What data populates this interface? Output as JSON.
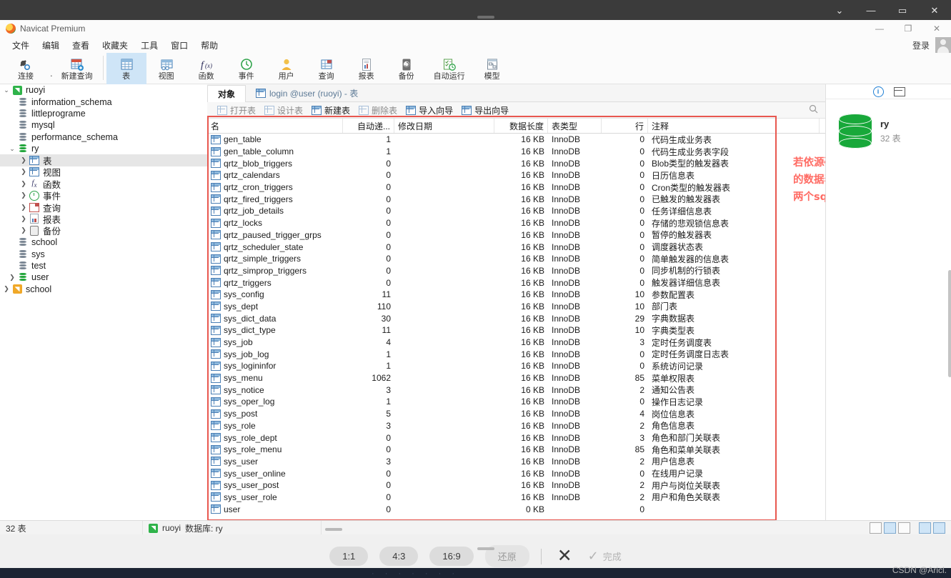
{
  "outer_window": {
    "buttons": [
      {
        "name": "chevron-down-icon",
        "glyph": "⌄"
      },
      {
        "name": "minimize-icon",
        "glyph": "—"
      },
      {
        "name": "maximize-icon",
        "glyph": "▭"
      },
      {
        "name": "close-icon",
        "glyph": "✕"
      }
    ]
  },
  "app": {
    "title": "Navicat Premium",
    "window_buttons": [
      {
        "name": "minimize-icon",
        "glyph": "—"
      },
      {
        "name": "restore-icon",
        "glyph": "❐"
      },
      {
        "name": "close-icon",
        "glyph": "✕"
      }
    ],
    "login_label": "登录"
  },
  "menu": {
    "items": [
      {
        "label": "文件"
      },
      {
        "label": "编辑"
      },
      {
        "label": "查看"
      },
      {
        "label": "收藏夹"
      },
      {
        "label": "工具"
      },
      {
        "label": "窗口"
      },
      {
        "label": "帮助"
      }
    ]
  },
  "ribbon": {
    "items": [
      {
        "label": "连接",
        "icon": "connection-icon",
        "active": false
      },
      {
        "label": "新建查询",
        "icon": "new-query-icon",
        "active": false
      },
      {
        "label": "表",
        "icon": "table-icon",
        "active": true
      },
      {
        "label": "视图",
        "icon": "view-icon",
        "active": false
      },
      {
        "label": "函数",
        "icon": "function-icon",
        "active": false
      },
      {
        "label": "事件",
        "icon": "event-icon",
        "active": false
      },
      {
        "label": "用户",
        "icon": "user-icon",
        "active": false
      },
      {
        "label": "查询",
        "icon": "query-icon",
        "active": false
      },
      {
        "label": "报表",
        "icon": "report-icon",
        "active": false
      },
      {
        "label": "备份",
        "icon": "backup-icon",
        "active": false
      },
      {
        "label": "自动运行",
        "icon": "automation-icon",
        "active": false
      },
      {
        "label": "模型",
        "icon": "model-icon",
        "active": false
      }
    ]
  },
  "sidebar": {
    "items": [
      {
        "label": "ruoyi",
        "icon": "connection-icon",
        "indent": 0,
        "twisty": "v",
        "selected": false
      },
      {
        "label": "information_schema",
        "icon": "database-icon",
        "indent": 1,
        "twisty": "",
        "selected": false
      },
      {
        "label": "littleprograme",
        "icon": "database-icon",
        "indent": 1,
        "twisty": "",
        "selected": false
      },
      {
        "label": "mysql",
        "icon": "database-icon",
        "indent": 1,
        "twisty": "",
        "selected": false
      },
      {
        "label": "performance_schema",
        "icon": "database-icon",
        "indent": 1,
        "twisty": "",
        "selected": false
      },
      {
        "label": "ry",
        "icon": "database-open-icon",
        "indent": 1,
        "twisty": "v",
        "selected": false
      },
      {
        "label": "表",
        "icon": "table-icon",
        "indent": 2,
        "twisty": ">",
        "selected": true
      },
      {
        "label": "视图",
        "icon": "view-icon",
        "indent": 2,
        "twisty": ">",
        "selected": false
      },
      {
        "label": "函数",
        "icon": "function-icon",
        "indent": 2,
        "twisty": ">",
        "selected": false
      },
      {
        "label": "事件",
        "icon": "event-icon",
        "indent": 2,
        "twisty": ">",
        "selected": false
      },
      {
        "label": "查询",
        "icon": "query-icon",
        "indent": 2,
        "twisty": ">",
        "selected": false
      },
      {
        "label": "报表",
        "icon": "report-icon",
        "indent": 2,
        "twisty": ">",
        "selected": false
      },
      {
        "label": "备份",
        "icon": "backup-icon",
        "indent": 2,
        "twisty": ">",
        "selected": false
      },
      {
        "label": "school",
        "icon": "database-icon",
        "indent": 1,
        "twisty": "",
        "selected": false
      },
      {
        "label": "sys",
        "icon": "database-icon",
        "indent": 1,
        "twisty": "",
        "selected": false
      },
      {
        "label": "test",
        "icon": "database-icon",
        "indent": 1,
        "twisty": "",
        "selected": false
      },
      {
        "label": "user",
        "icon": "database-open-icon",
        "indent": 1,
        "twisty": ">",
        "selected": false
      },
      {
        "label": "school",
        "icon": "connection-orange-icon",
        "indent": 0,
        "twisty": ">",
        "selected": false
      }
    ]
  },
  "tabs": [
    {
      "label": "对象",
      "active": true,
      "icon": ""
    },
    {
      "label": "login @user (ruoyi) - 表",
      "active": false,
      "icon": "table-icon"
    }
  ],
  "object_toolbar": [
    {
      "label": "打开表",
      "icon": "open-table-icon",
      "enabled": false
    },
    {
      "label": "设计表",
      "icon": "design-table-icon",
      "enabled": false
    },
    {
      "label": "新建表",
      "icon": "new-table-icon",
      "enabled": true
    },
    {
      "label": "删除表",
      "icon": "delete-table-icon",
      "enabled": false
    },
    {
      "label": "导入向导",
      "icon": "import-wizard-icon",
      "enabled": true
    },
    {
      "label": "导出向导",
      "icon": "export-wizard-icon",
      "enabled": true
    }
  ],
  "table_list": {
    "columns": [
      "名",
      "自动递...",
      "修改日期",
      "数据长度",
      "表类型",
      "行",
      "注释"
    ],
    "rows": [
      {
        "name": "gen_table",
        "auto": "1",
        "modified": "",
        "length": "16 KB",
        "type": "InnoDB",
        "rows": "0",
        "comment": "代码生成业务表"
      },
      {
        "name": "gen_table_column",
        "auto": "1",
        "modified": "",
        "length": "16 KB",
        "type": "InnoDB",
        "rows": "0",
        "comment": "代码生成业务表字段"
      },
      {
        "name": "qrtz_blob_triggers",
        "auto": "0",
        "modified": "",
        "length": "16 KB",
        "type": "InnoDB",
        "rows": "0",
        "comment": "Blob类型的触发器表"
      },
      {
        "name": "qrtz_calendars",
        "auto": "0",
        "modified": "",
        "length": "16 KB",
        "type": "InnoDB",
        "rows": "0",
        "comment": "日历信息表"
      },
      {
        "name": "qrtz_cron_triggers",
        "auto": "0",
        "modified": "",
        "length": "16 KB",
        "type": "InnoDB",
        "rows": "0",
        "comment": "Cron类型的触发器表"
      },
      {
        "name": "qrtz_fired_triggers",
        "auto": "0",
        "modified": "",
        "length": "16 KB",
        "type": "InnoDB",
        "rows": "0",
        "comment": "已触发的触发器表"
      },
      {
        "name": "qrtz_job_details",
        "auto": "0",
        "modified": "",
        "length": "16 KB",
        "type": "InnoDB",
        "rows": "0",
        "comment": "任务详细信息表"
      },
      {
        "name": "qrtz_locks",
        "auto": "0",
        "modified": "",
        "length": "16 KB",
        "type": "InnoDB",
        "rows": "0",
        "comment": "存储的悲观锁信息表"
      },
      {
        "name": "qrtz_paused_trigger_grps",
        "auto": "0",
        "modified": "",
        "length": "16 KB",
        "type": "InnoDB",
        "rows": "0",
        "comment": "暂停的触发器表"
      },
      {
        "name": "qrtz_scheduler_state",
        "auto": "0",
        "modified": "",
        "length": "16 KB",
        "type": "InnoDB",
        "rows": "0",
        "comment": "调度器状态表"
      },
      {
        "name": "qrtz_simple_triggers",
        "auto": "0",
        "modified": "",
        "length": "16 KB",
        "type": "InnoDB",
        "rows": "0",
        "comment": "简单触发器的信息表"
      },
      {
        "name": "qrtz_simprop_triggers",
        "auto": "0",
        "modified": "",
        "length": "16 KB",
        "type": "InnoDB",
        "rows": "0",
        "comment": "同步机制的行锁表"
      },
      {
        "name": "qrtz_triggers",
        "auto": "0",
        "modified": "",
        "length": "16 KB",
        "type": "InnoDB",
        "rows": "0",
        "comment": "触发器详细信息表"
      },
      {
        "name": "sys_config",
        "auto": "11",
        "modified": "",
        "length": "16 KB",
        "type": "InnoDB",
        "rows": "10",
        "comment": "参数配置表"
      },
      {
        "name": "sys_dept",
        "auto": "110",
        "modified": "",
        "length": "16 KB",
        "type": "InnoDB",
        "rows": "10",
        "comment": "部门表"
      },
      {
        "name": "sys_dict_data",
        "auto": "30",
        "modified": "",
        "length": "16 KB",
        "type": "InnoDB",
        "rows": "29",
        "comment": "字典数据表"
      },
      {
        "name": "sys_dict_type",
        "auto": "11",
        "modified": "",
        "length": "16 KB",
        "type": "InnoDB",
        "rows": "10",
        "comment": "字典类型表"
      },
      {
        "name": "sys_job",
        "auto": "4",
        "modified": "",
        "length": "16 KB",
        "type": "InnoDB",
        "rows": "3",
        "comment": "定时任务调度表"
      },
      {
        "name": "sys_job_log",
        "auto": "1",
        "modified": "",
        "length": "16 KB",
        "type": "InnoDB",
        "rows": "0",
        "comment": "定时任务调度日志表"
      },
      {
        "name": "sys_logininfor",
        "auto": "1",
        "modified": "",
        "length": "16 KB",
        "type": "InnoDB",
        "rows": "0",
        "comment": "系统访问记录"
      },
      {
        "name": "sys_menu",
        "auto": "1062",
        "modified": "",
        "length": "16 KB",
        "type": "InnoDB",
        "rows": "85",
        "comment": "菜单权限表"
      },
      {
        "name": "sys_notice",
        "auto": "3",
        "modified": "",
        "length": "16 KB",
        "type": "InnoDB",
        "rows": "2",
        "comment": "通知公告表"
      },
      {
        "name": "sys_oper_log",
        "auto": "1",
        "modified": "",
        "length": "16 KB",
        "type": "InnoDB",
        "rows": "0",
        "comment": "操作日志记录"
      },
      {
        "name": "sys_post",
        "auto": "5",
        "modified": "",
        "length": "16 KB",
        "type": "InnoDB",
        "rows": "4",
        "comment": "岗位信息表"
      },
      {
        "name": "sys_role",
        "auto": "3",
        "modified": "",
        "length": "16 KB",
        "type": "InnoDB",
        "rows": "2",
        "comment": "角色信息表"
      },
      {
        "name": "sys_role_dept",
        "auto": "0",
        "modified": "",
        "length": "16 KB",
        "type": "InnoDB",
        "rows": "3",
        "comment": "角色和部门关联表"
      },
      {
        "name": "sys_role_menu",
        "auto": "0",
        "modified": "",
        "length": "16 KB",
        "type": "InnoDB",
        "rows": "85",
        "comment": "角色和菜单关联表"
      },
      {
        "name": "sys_user",
        "auto": "3",
        "modified": "",
        "length": "16 KB",
        "type": "InnoDB",
        "rows": "2",
        "comment": "用户信息表"
      },
      {
        "name": "sys_user_online",
        "auto": "0",
        "modified": "",
        "length": "16 KB",
        "type": "InnoDB",
        "rows": "0",
        "comment": "在线用户记录"
      },
      {
        "name": "sys_user_post",
        "auto": "0",
        "modified": "",
        "length": "16 KB",
        "type": "InnoDB",
        "rows": "2",
        "comment": "用户与岗位关联表"
      },
      {
        "name": "sys_user_role",
        "auto": "0",
        "modified": "",
        "length": "16 KB",
        "type": "InnoDB",
        "rows": "2",
        "comment": "用户和角色关联表"
      },
      {
        "name": "user",
        "auto": "0",
        "modified": "",
        "length": "0 KB",
        "type": "",
        "rows": "0",
        "comment": ""
      }
    ]
  },
  "annotation": {
    "line1": "若依源码中自带",
    "line2": "的数据表，只需将上述的",
    "line3": "两个sql文件运行即可",
    "color": "#ff6b63"
  },
  "info_panel": {
    "db_name": "ry",
    "db_sub": "32 表",
    "info_icon": "i",
    "grid_icon": "grid-icon"
  },
  "statusbar": {
    "left": "32 表",
    "connection": "ruoyi",
    "database": "数据库: ry"
  },
  "capture_toolbar": {
    "ratios": [
      {
        "label": "1:1",
        "muted": false
      },
      {
        "label": "4:3",
        "muted": false
      },
      {
        "label": "16:9",
        "muted": false
      },
      {
        "label": "还原",
        "muted": true
      }
    ],
    "cancel_icon": "close-icon",
    "done_label": "完成"
  },
  "watermark": "CSDN @Aricl."
}
